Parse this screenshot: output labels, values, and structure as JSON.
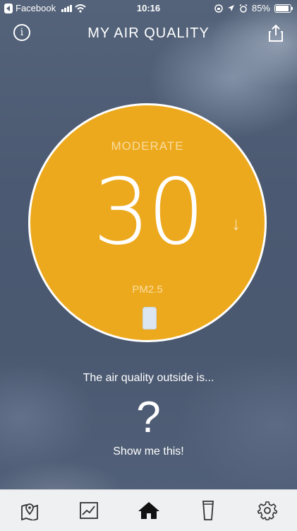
{
  "status_bar": {
    "back_app": "Facebook",
    "time": "10:16",
    "battery": "85%"
  },
  "header": {
    "title": "MY AIR QUALITY",
    "info_icon": "info-icon",
    "share_icon": "share-icon"
  },
  "reading": {
    "level": "MODERATE",
    "value": "30",
    "trend_symbol": "↓",
    "pollutant": "PM2.5",
    "color": "#eda91d"
  },
  "outside": {
    "text": "The air quality outside is...",
    "symbol": "?",
    "action": "Show me this!"
  },
  "tabs": [
    {
      "icon": "map-icon"
    },
    {
      "icon": "chart-icon"
    },
    {
      "icon": "home-icon",
      "active": true
    },
    {
      "icon": "device-icon"
    },
    {
      "icon": "gear-icon"
    }
  ]
}
